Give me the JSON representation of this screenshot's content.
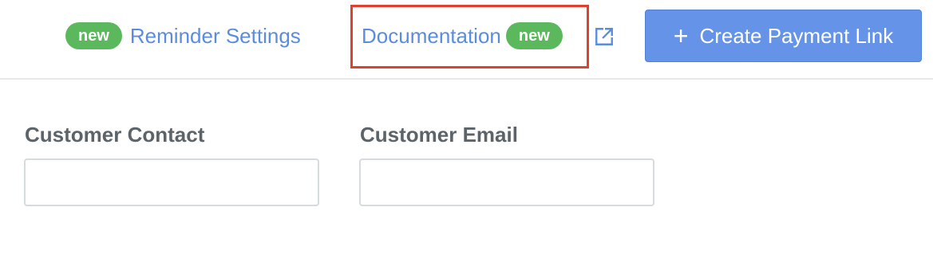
{
  "header": {
    "reminder": {
      "badge": "new",
      "label": "Reminder Settings"
    },
    "documentation": {
      "label": "Documentation",
      "badge": "new",
      "external_icon": "external-link-icon"
    },
    "create_button": {
      "icon": "plus-icon",
      "label": "Create Payment Link"
    }
  },
  "filters": {
    "customer_contact": {
      "label": "Customer Contact",
      "value": "",
      "placeholder": ""
    },
    "customer_email": {
      "label": "Customer Email",
      "value": "",
      "placeholder": ""
    }
  },
  "colors": {
    "badge_green": "#5cb85c",
    "link_blue": "#5a8de0",
    "button_blue": "#6593e8",
    "highlight_red": "#e0402c",
    "label_gray": "#5c6369"
  }
}
